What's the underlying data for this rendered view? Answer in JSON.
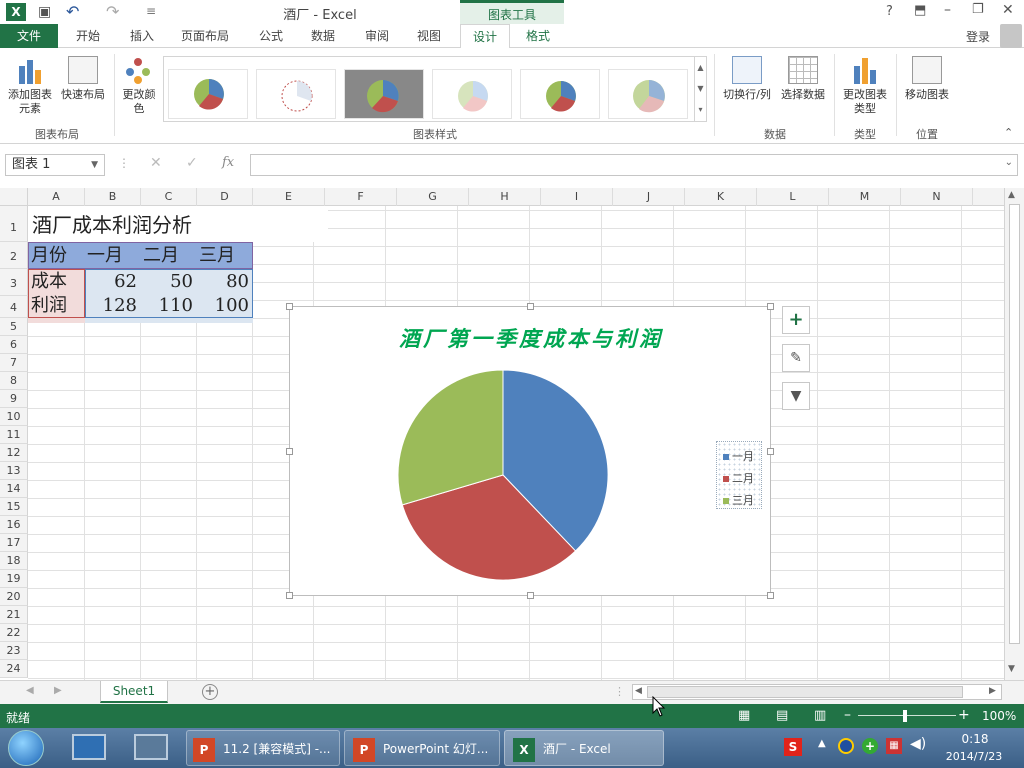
{
  "window": {
    "title": "酒厂 - Excel",
    "context_tab": "图表工具",
    "help": "?",
    "signin": "登录"
  },
  "tabs": [
    "文件",
    "开始",
    "插入",
    "页面布局",
    "公式",
    "数据",
    "审阅",
    "视图",
    "设计",
    "格式"
  ],
  "ribbon": {
    "add_element": "添加图表元素",
    "quick_layout": "快速布局",
    "change_colors": "更改颜色",
    "switch_rowcol": "切换行/列",
    "select_data": "选择数据",
    "change_type": "更改图表类型",
    "move_chart": "移动图表",
    "group_layout": "图表布局",
    "group_styles": "图表样式",
    "group_data": "数据",
    "group_type": "类型",
    "group_location": "位置"
  },
  "formula": {
    "namebox": "图表 1",
    "fx": "fx",
    "content": ""
  },
  "columns": [
    "A",
    "B",
    "C",
    "D",
    "E",
    "F",
    "G",
    "H",
    "I",
    "J",
    "K",
    "L",
    "M",
    "N"
  ],
  "rows": [
    "1",
    "2",
    "3",
    "4",
    "5",
    "6",
    "7",
    "8",
    "9",
    "10",
    "11",
    "12",
    "13",
    "14",
    "15",
    "16",
    "17",
    "18",
    "19",
    "20",
    "21",
    "22",
    "23",
    "24"
  ],
  "sheet": {
    "title": "酒厂成本利润分析",
    "header": [
      "月份",
      "一月",
      "二月",
      "三月"
    ],
    "row_cost": [
      "成本",
      "62",
      "50",
      "80"
    ],
    "row_profit": [
      "利润",
      "128",
      "110",
      "100"
    ]
  },
  "chart_data": {
    "type": "pie",
    "title": "酒厂第一季度成本与利润",
    "categories": [
      "一月",
      "二月",
      "三月"
    ],
    "values": [
      128,
      110,
      100
    ],
    "colors": [
      "#4f81bd",
      "#c0504d",
      "#9bbb59"
    ],
    "legend": "right"
  },
  "sheetbar": {
    "tab": "Sheet1"
  },
  "status": {
    "ready": "就绪",
    "zoom": "100%"
  },
  "taskbar": {
    "ppt1": "11.2 [兼容模式] -...",
    "ppt2": "PowerPoint 幻灯...",
    "excel": "酒厂 - Excel",
    "time": "0:18",
    "date": "2014/7/23"
  }
}
